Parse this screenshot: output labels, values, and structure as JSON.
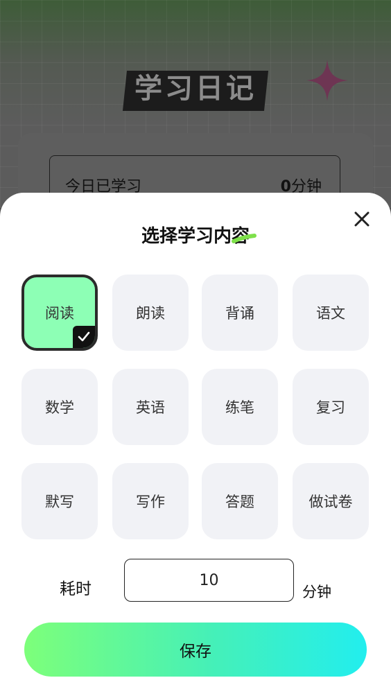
{
  "background": {
    "page_title": "学习日记",
    "study_label": "今日已学习",
    "study_minutes": "0",
    "study_unit": "分钟"
  },
  "sheet": {
    "title": "选择学习内容",
    "close_icon": "close-icon",
    "options": [
      {
        "label": "阅读",
        "selected": true
      },
      {
        "label": "朗读",
        "selected": false
      },
      {
        "label": "背诵",
        "selected": false
      },
      {
        "label": "语文",
        "selected": false
      },
      {
        "label": "数学",
        "selected": false
      },
      {
        "label": "英语",
        "selected": false
      },
      {
        "label": "练笔",
        "selected": false
      },
      {
        "label": "复习",
        "selected": false
      },
      {
        "label": "默写",
        "selected": false
      },
      {
        "label": "写作",
        "selected": false
      },
      {
        "label": "答题",
        "selected": false
      },
      {
        "label": "做试卷",
        "selected": false
      }
    ],
    "duration_label": "耗时",
    "duration_value": "10",
    "duration_unit": "分钟",
    "save_label": "保存"
  },
  "colors": {
    "selected_tile": "#8dffb5",
    "tile": "#f1f2f6",
    "save_gradient_start": "#7dff7a",
    "save_gradient_end": "#22eeee",
    "accent_star": "#8a3a5e"
  }
}
